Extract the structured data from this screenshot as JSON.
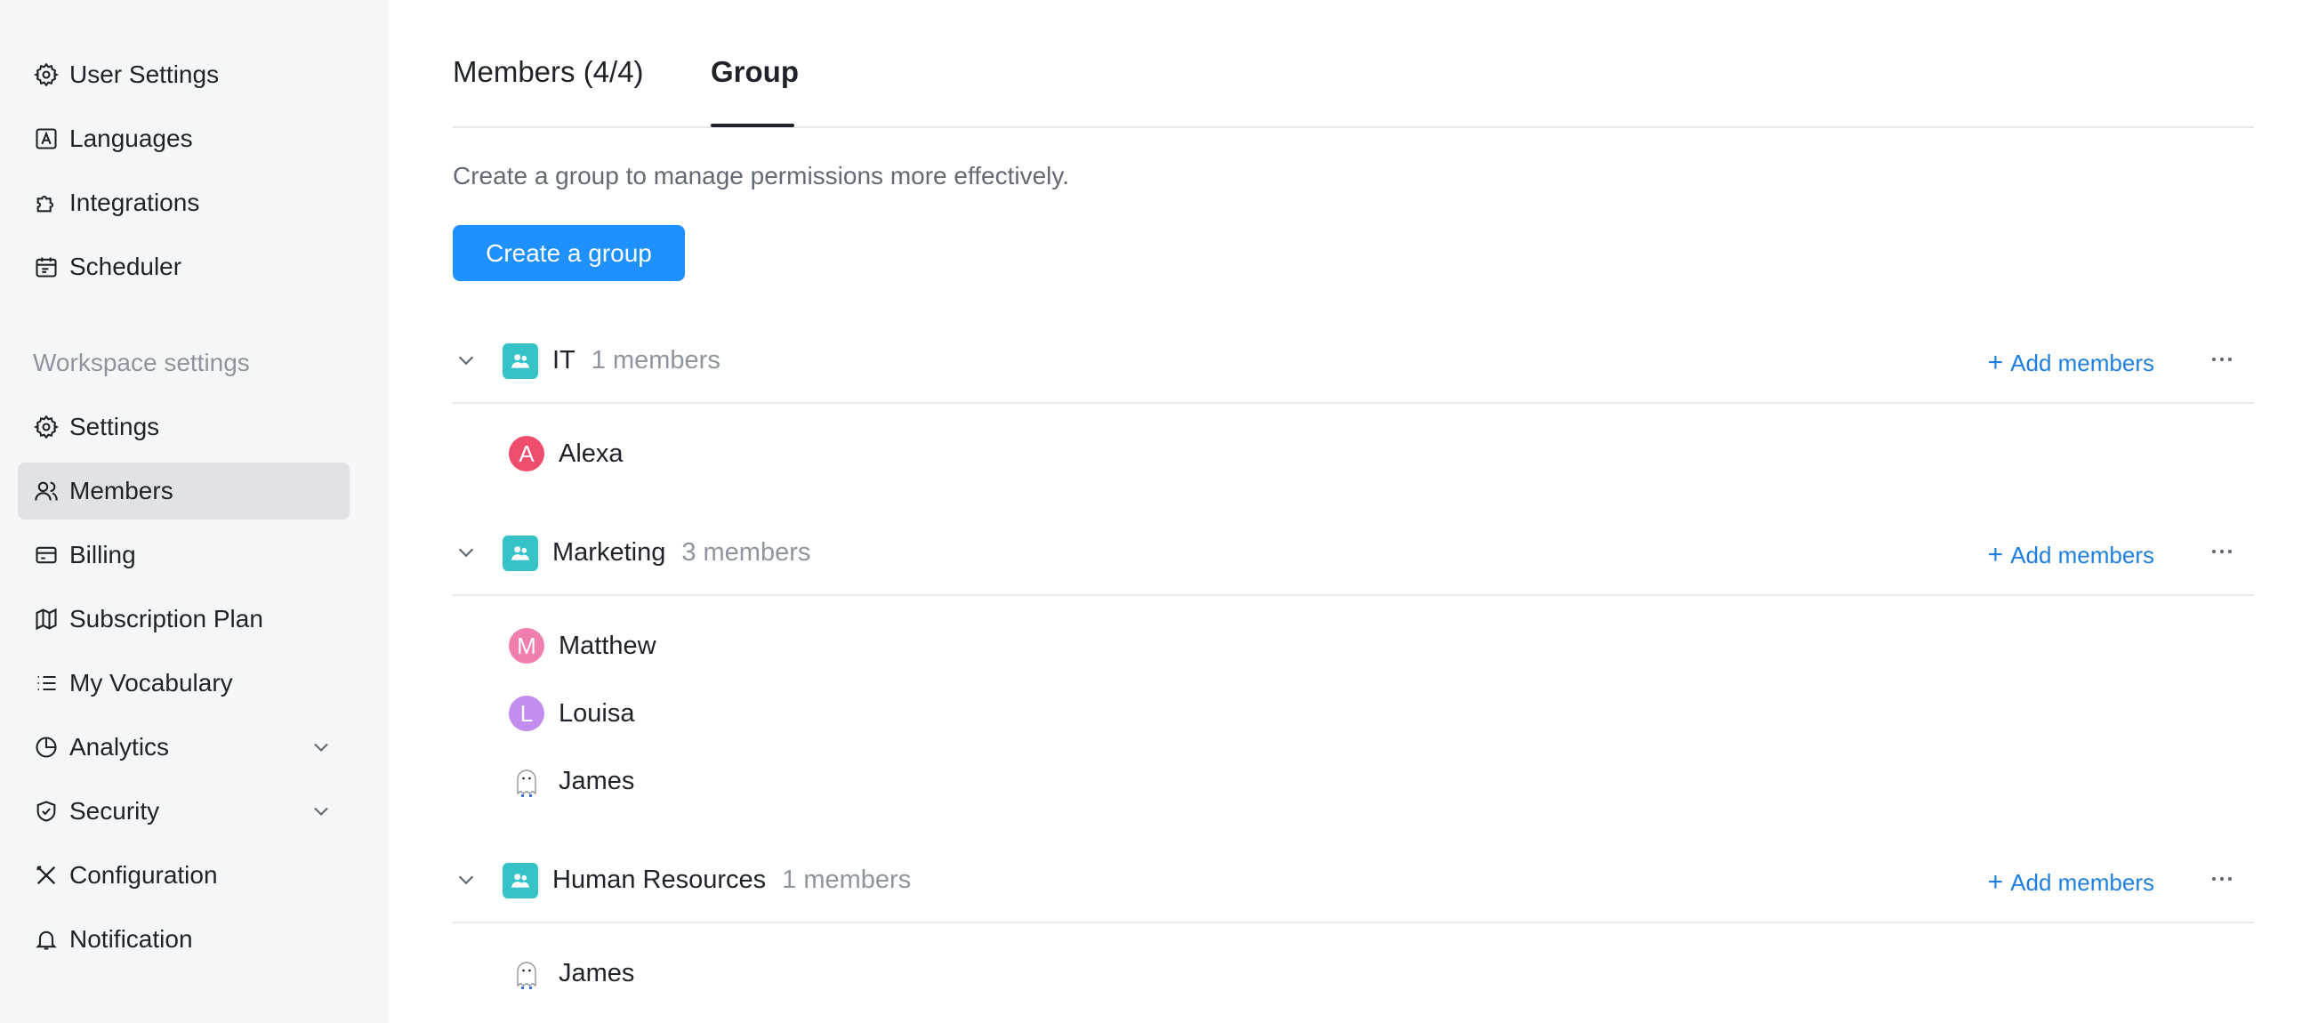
{
  "sidebar": {
    "items": [
      {
        "label": "User Settings",
        "icon": "gear-icon"
      },
      {
        "label": "Languages",
        "icon": "language-icon"
      },
      {
        "label": "Integrations",
        "icon": "puzzle-icon"
      },
      {
        "label": "Scheduler",
        "icon": "calendar-icon"
      }
    ],
    "section_title": "Workspace settings",
    "workspace_items": [
      {
        "label": "Settings",
        "icon": "gear-icon"
      },
      {
        "label": "Members",
        "icon": "users-icon",
        "active": true
      },
      {
        "label": "Billing",
        "icon": "card-icon"
      },
      {
        "label": "Subscription Plan",
        "icon": "map-icon"
      },
      {
        "label": "My Vocabulary",
        "icon": "list-icon"
      },
      {
        "label": "Analytics",
        "icon": "pie-chart-icon"
      },
      {
        "label": "Security",
        "icon": "shield-icon"
      },
      {
        "label": "Configuration",
        "icon": "tools-icon"
      },
      {
        "label": "Notification",
        "icon": "bell-icon"
      }
    ]
  },
  "tabs": [
    {
      "label": "Members  (4/4)"
    },
    {
      "label": "Group",
      "active": true
    }
  ],
  "description": "Create a group to manage permissions more effectively.",
  "create_button": "Create a group",
  "add_members_label": "Add members",
  "groups": [
    {
      "name": "IT",
      "count": "1 members",
      "members": [
        {
          "name": "Alexa",
          "initial": "A",
          "color": "#ee4d6e"
        }
      ]
    },
    {
      "name": "Marketing",
      "count": "3 members",
      "members": [
        {
          "name": "Matthew",
          "initial": "M",
          "color": "#f07fb0"
        },
        {
          "name": "Louisa",
          "initial": "L",
          "color": "#c38df0"
        },
        {
          "name": "James",
          "initial": "",
          "color": "ghost"
        }
      ]
    },
    {
      "name": "Human Resources",
      "count": "1 members",
      "members": [
        {
          "name": "James",
          "initial": "",
          "color": "ghost"
        }
      ]
    }
  ],
  "colors": {
    "accent": "#1e90ff",
    "group_icon": "#36c3c8"
  }
}
